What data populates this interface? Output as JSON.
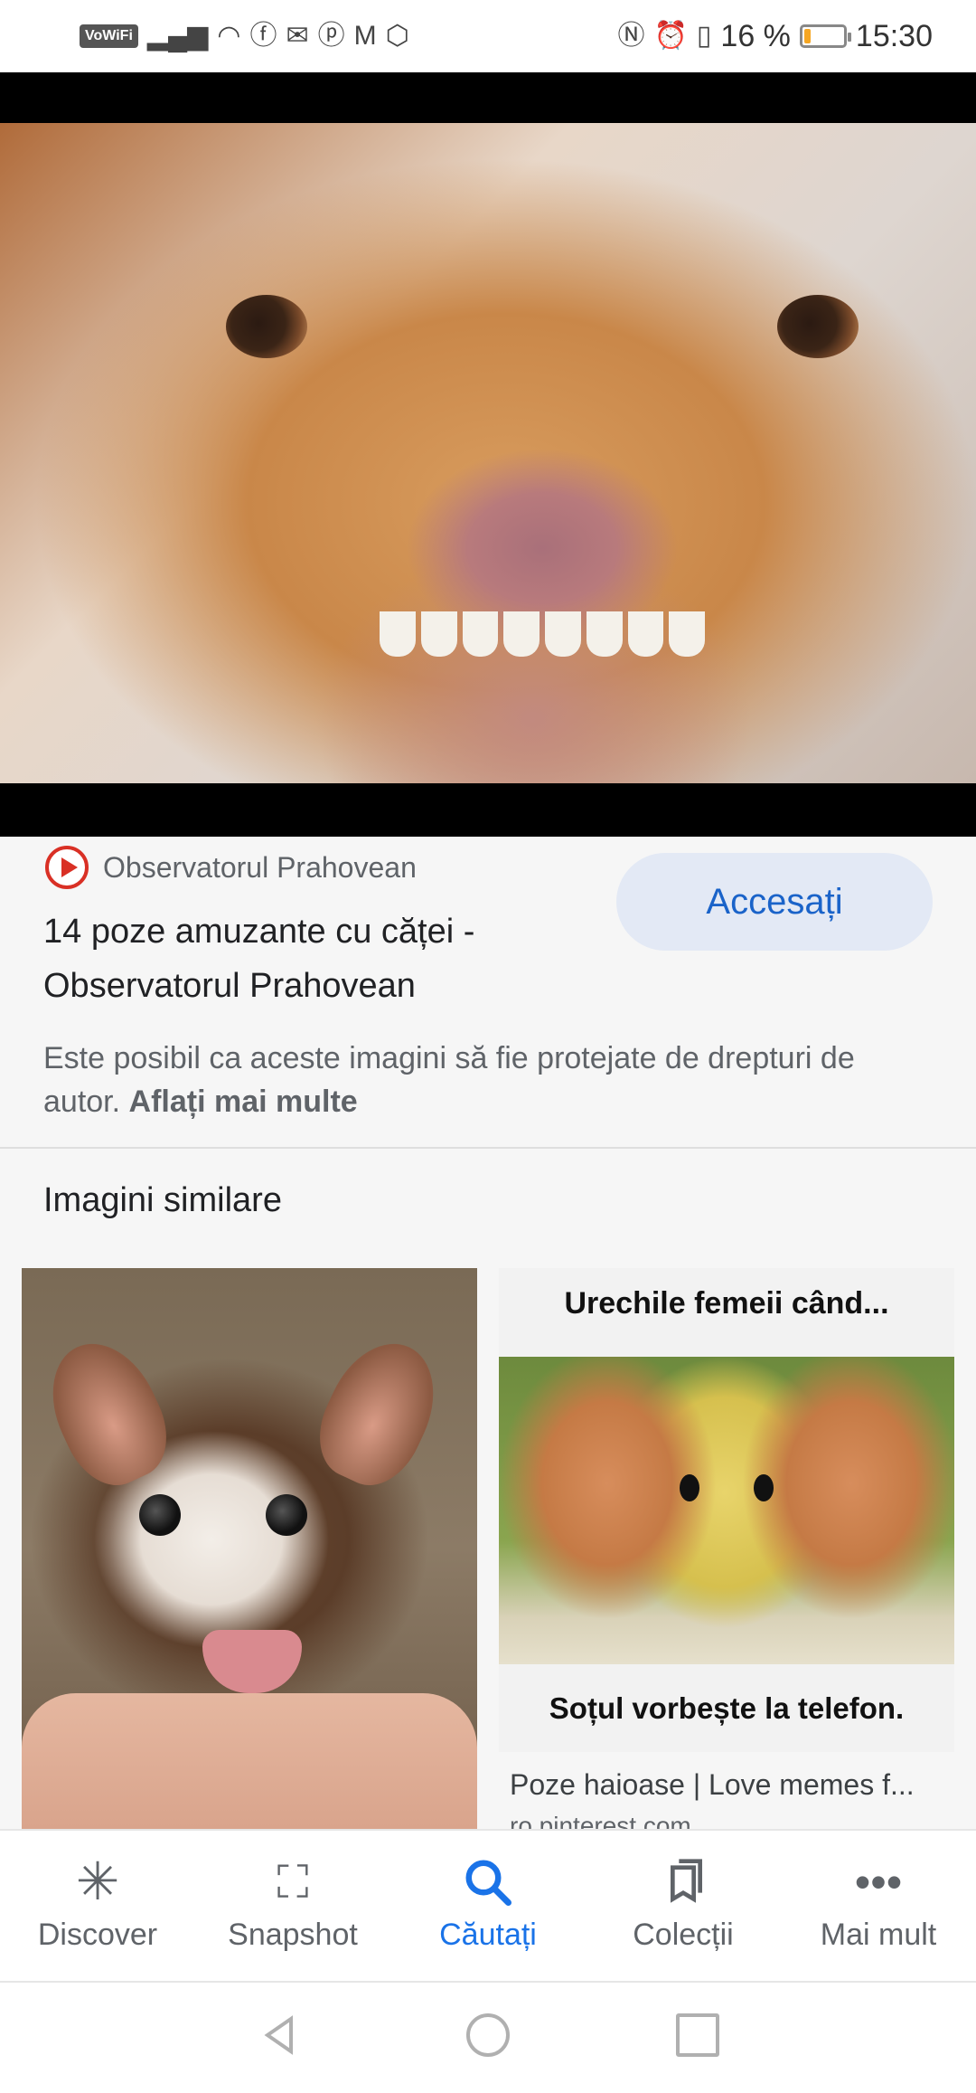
{
  "status_bar": {
    "vowifi": "VoWiFi",
    "battery_percent": "16 %",
    "battery_level": 0.16,
    "time": "15:30",
    "left_icons": [
      "signal-icon",
      "wifi-icon",
      "facebook-icon",
      "mail-icon",
      "pinterest-icon",
      "gmail-icon",
      "shield-icon"
    ],
    "right_icons": [
      "nfc-icon",
      "alarm-icon",
      "vibrate-icon"
    ]
  },
  "result": {
    "source_name": "Observatorul Prahovean",
    "title": "14 poze amuzante cu căței - Observatorul Prahovean",
    "visit_label": "Accesați",
    "copyright_text": "Este posibil ca aceste imagini să fie protejate de drepturi de autor.",
    "learn_more": "Aflați mai multe"
  },
  "similar": {
    "heading": "Imagini similare",
    "items": [
      {
        "caption": "",
        "source": ""
      },
      {
        "meme_top": "Urechile femeii când...",
        "meme_bottom": "Soțul vorbește la telefon.",
        "caption": "Poze haioase | Love memes f...",
        "source": "ro.pinterest.com"
      }
    ]
  },
  "bottom_nav": {
    "items": [
      {
        "label": "Discover",
        "icon": "asterisk-icon"
      },
      {
        "label": "Snapshot",
        "icon": "snapshot-icon"
      },
      {
        "label": "Căutați",
        "icon": "search-icon",
        "active": true
      },
      {
        "label": "Colecții",
        "icon": "collections-icon"
      },
      {
        "label": "Mai mult",
        "icon": "more-icon"
      }
    ]
  },
  "colors": {
    "accent": "#1a73e8",
    "visit_button_bg": "#e3e9f5",
    "source_logo": "#d93025"
  }
}
